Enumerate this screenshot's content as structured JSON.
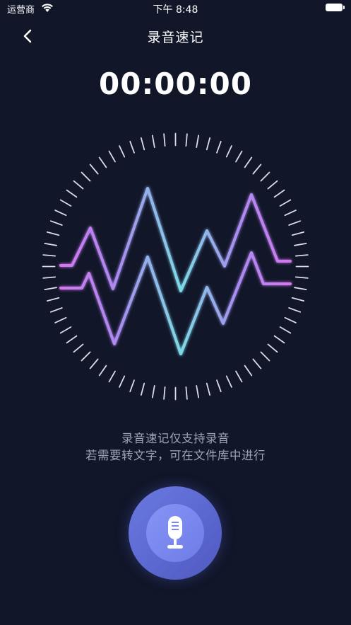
{
  "status_bar": {
    "carrier": "运营商",
    "time": "下午 8:48",
    "wifi_icon": "wifi-icon",
    "battery_icon": "battery-icon"
  },
  "nav": {
    "back_icon": "chevron-left-icon",
    "title": "录音速记"
  },
  "timer": "00:00:00",
  "visualizer": {
    "icon": "audio-waveform-icon",
    "colors": {
      "pink": "#e86cf0",
      "purple": "#a98cf0",
      "cyan": "#7ddbe6"
    }
  },
  "hint": {
    "line1": "录音速记仅支持录音",
    "line2": "若需要转文字，可在文件库中进行"
  },
  "record_button": {
    "icon": "microphone-icon",
    "color": "#6a79e2"
  }
}
